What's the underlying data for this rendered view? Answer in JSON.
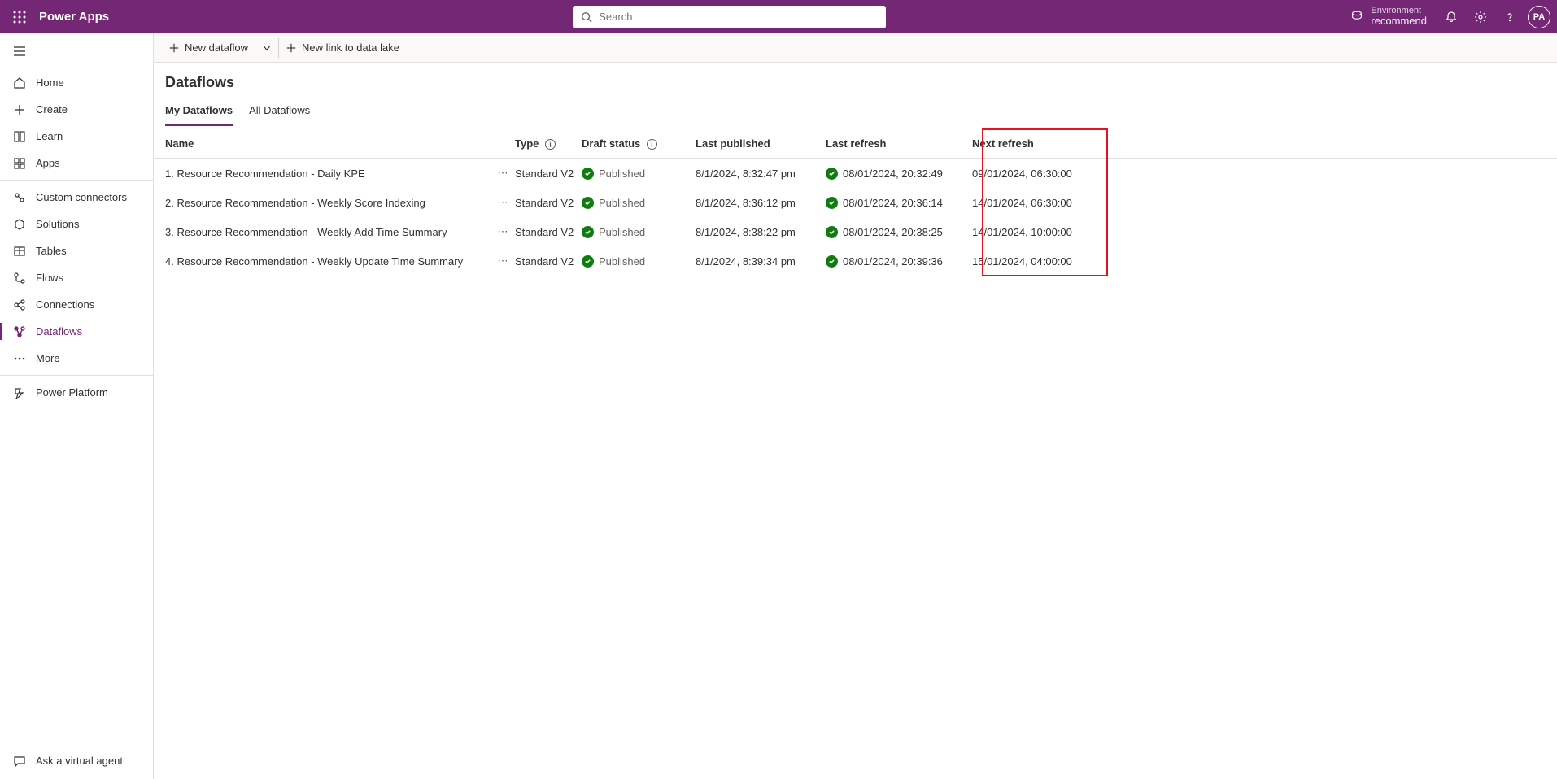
{
  "header": {
    "app_title": "Power Apps",
    "search_placeholder": "Search",
    "env_label": "Environment",
    "env_name": "recommend",
    "avatar_initials": "PA"
  },
  "sidebar": {
    "items": [
      {
        "id": "home",
        "label": "Home"
      },
      {
        "id": "create",
        "label": "Create"
      },
      {
        "id": "learn",
        "label": "Learn"
      },
      {
        "id": "apps",
        "label": "Apps"
      },
      {
        "id": "custom-connectors",
        "label": "Custom connectors"
      },
      {
        "id": "solutions",
        "label": "Solutions"
      },
      {
        "id": "tables",
        "label": "Tables"
      },
      {
        "id": "flows",
        "label": "Flows"
      },
      {
        "id": "connections",
        "label": "Connections"
      },
      {
        "id": "dataflows",
        "label": "Dataflows"
      },
      {
        "id": "more",
        "label": "More"
      },
      {
        "id": "power-platform",
        "label": "Power Platform"
      }
    ],
    "bottom": {
      "ask_agent": "Ask a virtual agent"
    }
  },
  "commands": {
    "new_dataflow": "New dataflow",
    "new_link_datalake": "New link to data lake"
  },
  "page": {
    "title": "Dataflows",
    "tabs": {
      "my": "My Dataflows",
      "all": "All Dataflows"
    }
  },
  "columns": {
    "name": "Name",
    "type": "Type",
    "draft_status": "Draft status",
    "last_published": "Last published",
    "last_refresh": "Last refresh",
    "next_refresh": "Next refresh"
  },
  "rows": [
    {
      "name": "1. Resource Recommendation - Daily KPE",
      "type": "Standard V2",
      "status": "Published",
      "last_published": "8/1/2024, 8:32:47 pm",
      "last_refresh": "08/01/2024, 20:32:49",
      "next_refresh": "09/01/2024, 06:30:00"
    },
    {
      "name": "2. Resource Recommendation - Weekly Score Indexing",
      "type": "Standard V2",
      "status": "Published",
      "last_published": "8/1/2024, 8:36:12 pm",
      "last_refresh": "08/01/2024, 20:36:14",
      "next_refresh": "14/01/2024, 06:30:00"
    },
    {
      "name": "3. Resource Recommendation - Weekly Add Time Summary",
      "type": "Standard V2",
      "status": "Published",
      "last_published": "8/1/2024, 8:38:22 pm",
      "last_refresh": "08/01/2024, 20:38:25",
      "next_refresh": "14/01/2024, 10:00:00"
    },
    {
      "name": "4. Resource Recommendation - Weekly Update Time Summary",
      "type": "Standard V2",
      "status": "Published",
      "last_published": "8/1/2024, 8:39:34 pm",
      "last_refresh": "08/01/2024, 20:39:36",
      "next_refresh": "15/01/2024, 04:00:00"
    }
  ]
}
